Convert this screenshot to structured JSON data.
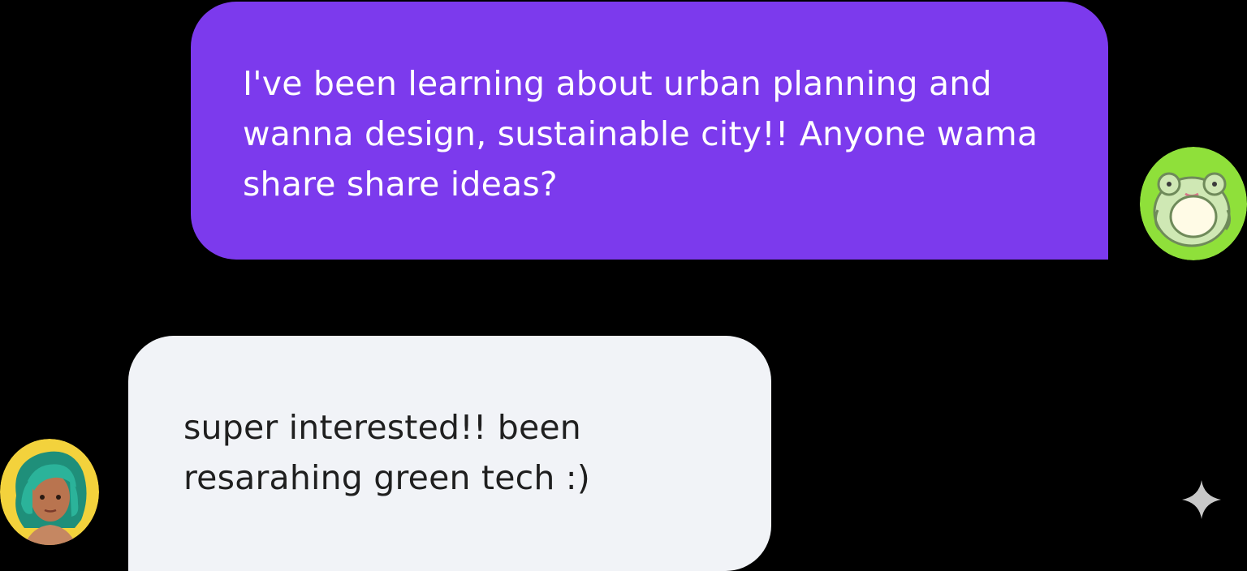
{
  "chat": {
    "messages": [
      {
        "sender": "me",
        "text": "I've been learning about urban planning and\nwanna design, sustainable city!! Anyone wama\nshare share ideas?",
        "avatar_icon": "frog-avatar-icon"
      },
      {
        "sender": "other",
        "text": "super interested!! been\nresarahing green tech :)",
        "avatar_icon": "woman-avatar-icon"
      }
    ]
  },
  "colors": {
    "background": "#000000",
    "outgoing_bubble": "#7c3aed",
    "incoming_bubble": "#f1f3f7",
    "outgoing_text": "#ffffff",
    "incoming_text": "#1f1f1f",
    "frog_avatar_bg": "#8fe03a",
    "woman_avatar_bg": "#f3d23c"
  },
  "watermark": {
    "icon": "sparkle-icon"
  }
}
